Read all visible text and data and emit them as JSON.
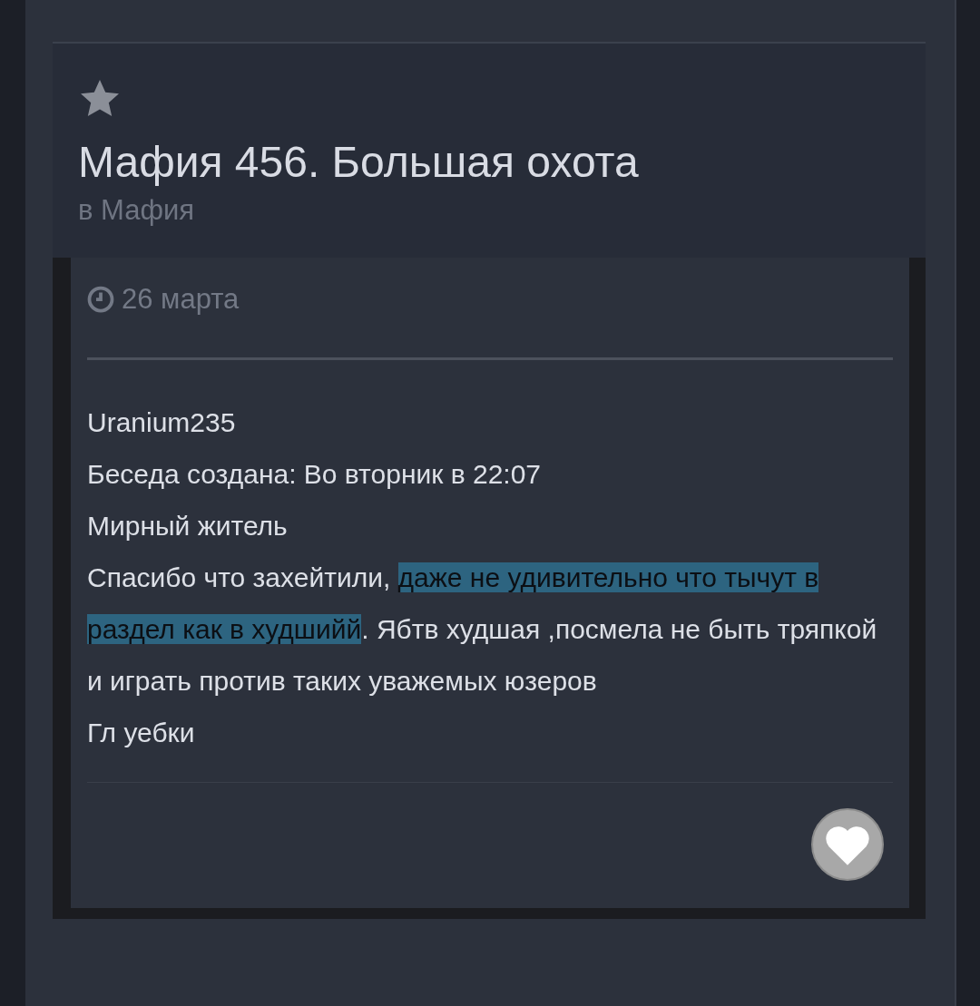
{
  "topic": {
    "title": "Мафия 456. Большая охота",
    "section": "в Мафия"
  },
  "post": {
    "date": "26 марта",
    "lines": [
      {
        "segments": [
          {
            "text": "Uranium235",
            "selected": false
          }
        ]
      },
      {
        "segments": [
          {
            "text": "Беседа создана: Во вторник в 22:07",
            "selected": false
          }
        ]
      },
      {
        "segments": [
          {
            "text": "Мирный житель",
            "selected": false
          }
        ]
      },
      {
        "segments": [
          {
            "text": "Спасибо что захейтили, ",
            "selected": false
          },
          {
            "text": "даже не удивительно что тычут в раздел как в худшийй",
            "selected": true
          },
          {
            "text": ". Ябтв худшая ,посмела не быть тряпкой и играть против таких уважемых юзеров",
            "selected": false
          }
        ]
      },
      {
        "segments": [
          {
            "text": "Гл уебки",
            "selected": false
          }
        ]
      }
    ]
  }
}
